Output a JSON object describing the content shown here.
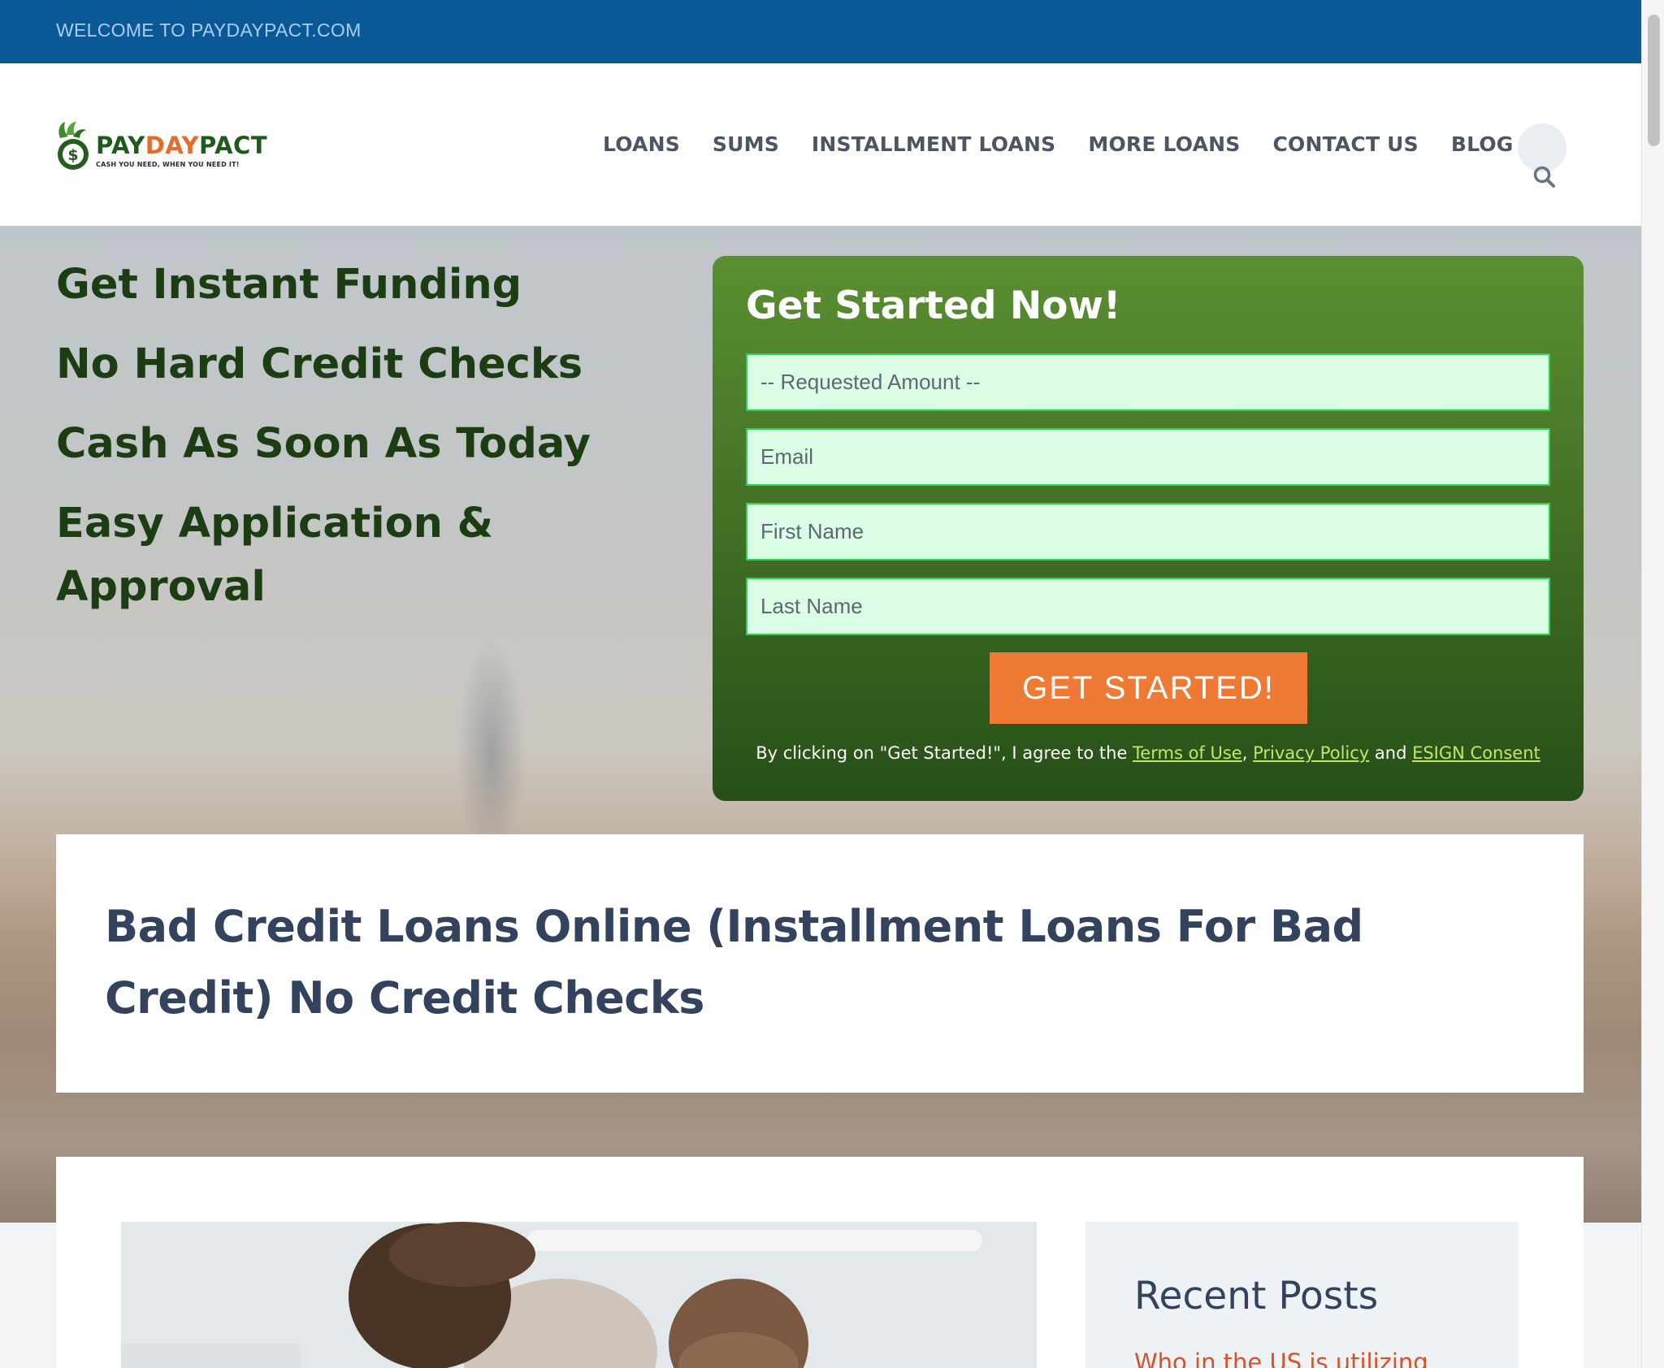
{
  "topbar": {
    "welcome": "WELCOME TO PAYDAYPACT.COM"
  },
  "header": {
    "logo": {
      "part1": "PAY",
      "part2": "DAY",
      "part3": "PACT",
      "tagline": "CASH YOU NEED, WHEN YOU NEED IT!",
      "coin_symbol": "$"
    },
    "nav": [
      "LOANS",
      "SUMS",
      "INSTALLMENT LOANS",
      "MORE LOANS",
      "CONTACT US",
      "BLOG"
    ],
    "search_icon": "search-icon"
  },
  "hero": {
    "lines": [
      "Get Instant Funding",
      "No Hard Credit Checks",
      "Cash As Soon As Today",
      "Easy Application & Approval"
    ]
  },
  "form": {
    "title": "Get Started Now!",
    "amount_placeholder": "-- Requested Amount --",
    "email_placeholder": "Email",
    "first_name_placeholder": "First Name",
    "last_name_placeholder": "Last Name",
    "submit_label": "GET STARTED!",
    "consent_prefix": "By clicking on \"Get Started!\", I agree to the ",
    "terms_label": "Terms of Use",
    "privacy_label": "Privacy Policy",
    "and_text": " and ",
    "esign_label": "ESIGN Consent",
    "comma": ","
  },
  "article": {
    "title": "Bad Credit Loans Online (Installment Loans For Bad Credit) No Credit Checks"
  },
  "sidebar": {
    "title": "Recent Posts",
    "first_post": "Who in the US is utilizing"
  },
  "colors": {
    "topbar": "#0b5896",
    "brand_green": "#1f5a1c",
    "brand_orange": "#e56c2b",
    "button": "#ee7a35",
    "field_bg": "#dcfde5",
    "link_accent": "#c4e56b",
    "post_link": "#d5522a"
  }
}
